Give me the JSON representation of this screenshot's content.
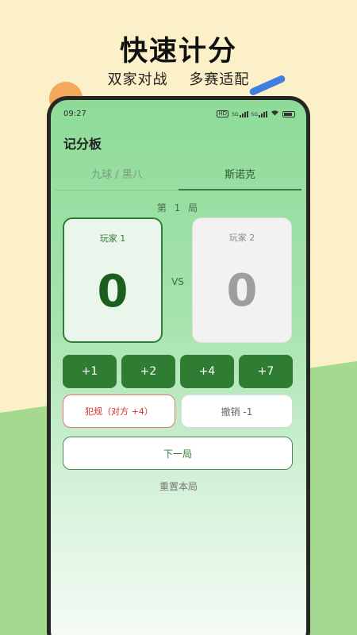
{
  "banner": {
    "headline": "快速计分",
    "tagline_left": "双家对战",
    "tagline_right": "多赛适配"
  },
  "status_bar": {
    "time": "09:27",
    "signal_label_1": "5G",
    "signal_label_2": "5G"
  },
  "app": {
    "title": "记分板",
    "tabs": [
      {
        "label": "九球 / 黑八",
        "active": false
      },
      {
        "label": "斯诺克",
        "active": true
      }
    ],
    "round_label": "第 1 局",
    "players": [
      {
        "name": "玩家 1",
        "score": "0",
        "active": true
      },
      {
        "name": "玩家 2",
        "score": "0",
        "active": false
      }
    ],
    "vs_label": "VS",
    "add_buttons": [
      "+1",
      "+2",
      "+4",
      "+7"
    ],
    "foul_button": "犯规（对方 +4）",
    "undo_button": "撤销 -1",
    "next_round_button": "下一局",
    "reset_link": "重置本局"
  },
  "colors": {
    "primary_green": "#2e7d32",
    "background_cream": "#fbf0c7",
    "background_green": "#a5d98f",
    "foul_red": "#d32f2f",
    "accent_orange": "#f3a85c",
    "accent_blue": "#3e7fe0"
  }
}
